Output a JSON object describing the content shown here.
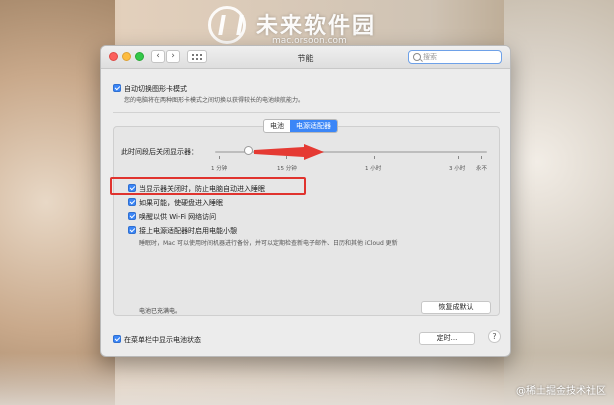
{
  "watermark": {
    "title": "未来软件园",
    "url": "mac.orsoon.com"
  },
  "window": {
    "title": "节能",
    "search_placeholder": "搜索"
  },
  "top_option": {
    "label": "自动切换图形卡模式",
    "desc": "您的电脑将在两种图形卡模式之间切换以获得较长的电池续航能力。"
  },
  "tabs": [
    {
      "label": "电池"
    },
    {
      "label": "电源适配器"
    }
  ],
  "slider": {
    "label": "此时间段后关闭显示器：",
    "ticks": [
      "1 分钟",
      "15 分钟",
      "1 小时",
      "3 小时",
      "永不"
    ],
    "value": "1 分钟"
  },
  "options": [
    {
      "label": "当显示器关闭时，防止电脑自动进入睡眠",
      "checked": true
    },
    {
      "label": "如果可能，使硬盘进入睡眠",
      "checked": true
    },
    {
      "label": "唤醒以供 Wi-Fi 网络访问",
      "checked": true
    },
    {
      "label": "接上电源适配器时启用电能小憩",
      "checked": true
    }
  ],
  "powernap_desc": "睡眠时，Mac 可以使用时间机器进行备份，并可以定期检查新电子邮件、日历和其他 iCloud 更新",
  "status": "电池已充满电。",
  "buttons": {
    "restore": "恢复成默认",
    "schedule": "定时...",
    "help": "?"
  },
  "menu_option": {
    "label": "在菜单栏中显示电池状态",
    "checked": true
  },
  "footer": "@稀土掘金技术社区"
}
